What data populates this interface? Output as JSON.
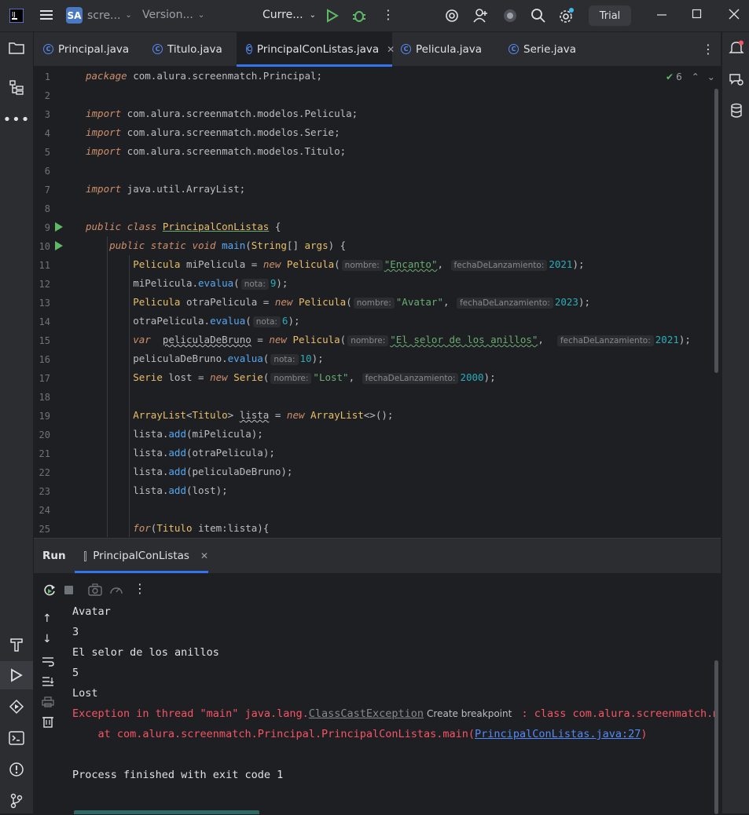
{
  "titlebar": {
    "project_badge": "SA",
    "project_name": "scre...",
    "vcs": "Version...",
    "run_config": "Curre...",
    "trial": "Trial"
  },
  "tabs": [
    {
      "label": "Principal.java"
    },
    {
      "label": "Titulo.java"
    },
    {
      "label": "PrincipalConListas.java"
    },
    {
      "label": "Pelicula.java"
    },
    {
      "label": "Serie.java"
    }
  ],
  "editor": {
    "inspection_count": "6",
    "line_numbers": [
      "1",
      "2",
      "3",
      "4",
      "5",
      "6",
      "7",
      "8",
      "9",
      "10",
      "11",
      "12",
      "13",
      "14",
      "15",
      "16",
      "17",
      "18",
      "19",
      "20",
      "21",
      "22",
      "23",
      "24",
      "25"
    ],
    "code": {
      "l1_kw": "package",
      "l1_rest": " com.alura.screenmatch.Principal;",
      "import": "import",
      "l3": " com.alura.screenmatch.modelos.Pelicula;",
      "l4": " com.alura.screenmatch.modelos.Serie;",
      "l5": " com.alura.screenmatch.modelos.Titulo;",
      "l7": " java.util.ArrayList;",
      "public": "public",
      "class": "class",
      "static": "static",
      "void": "void",
      "new": "new",
      "var": "var",
      "for": "for",
      "class_name": "PrincipalConListas",
      "main": "main",
      "string": "String",
      "args": "args",
      "pelicula": "Pelicula",
      "serie": "Serie",
      "miPelicula": "miPelicula",
      "otraPelicula": "otraPelicula",
      "peliculaDeBruno": "peliculaDeBruno",
      "lost": "lost",
      "evalua": "evalua",
      "hint_nombre": "nombre:",
      "hint_fecha": "fechaDeLanzamiento:",
      "hint_nota": "nota:",
      "s_encanto": "\"Encanto\"",
      "s_avatar": "\"Avatar\"",
      "s_bruno": "\"El selor de los anillos\"",
      "s_lost": "\"Lost\"",
      "n2021": "2021",
      "n2023": "2023",
      "n2000": "2000",
      "n9": "9",
      "n6": "6",
      "n10": "10",
      "arraylist": "ArrayList",
      "titulo": "Titulo",
      "lista": "lista",
      "add": "add",
      "item": "item"
    }
  },
  "run": {
    "title": "Run",
    "tab_label": "PrincipalConListas",
    "console": {
      "line1": "Avatar",
      "line2": "3",
      "line3": "El selor de los anillos",
      "line4": "5",
      "line5": "Lost",
      "exc_prefix": "Exception in thread \"main\" java.lang.",
      "exc_class": "ClassCastException",
      "create_bp": "Create breakpoint",
      "exc_suffix": " : class com.alura.screenmatch.mod",
      "at_prefix": "    at com.alura.screenmatch.Principal.PrincipalConListas.main(",
      "at_link": "PrincipalConListas.java:27",
      "at_suffix": ")",
      "finished": "Process finished with exit code 1"
    }
  },
  "colors": {
    "accent": "#3574f0",
    "error": "#f75464",
    "run_green": "#5fb865"
  }
}
